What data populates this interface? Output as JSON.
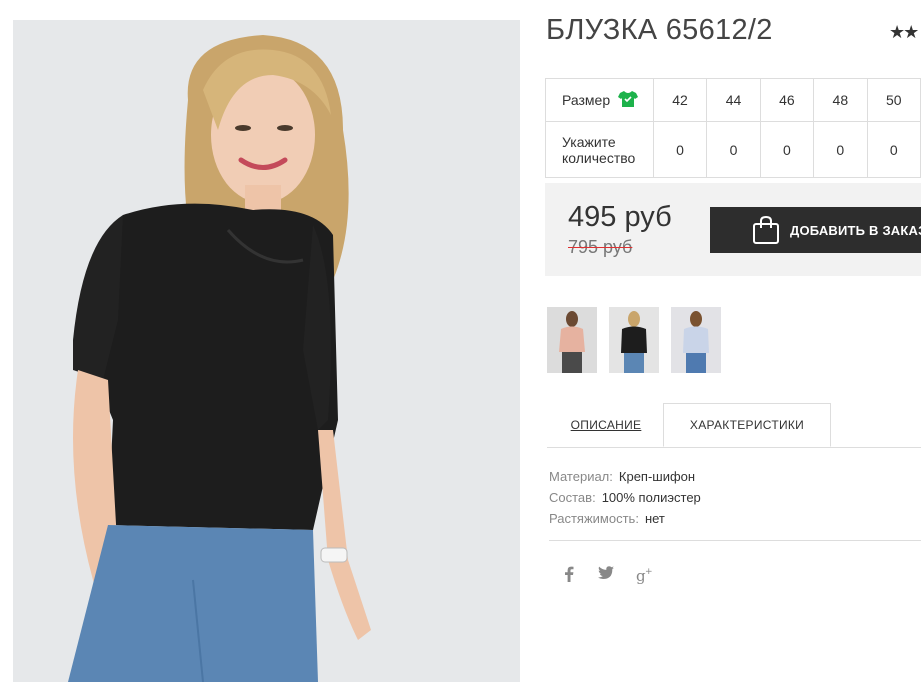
{
  "product": {
    "title": "БЛУЗКА 65612/2",
    "rating_stars": "★★"
  },
  "sizes": {
    "size_label": "Размер",
    "size_icon": "tshirt-icon",
    "quantity_label": "Укажите количество",
    "columns": [
      {
        "size": "42",
        "qty": "0"
      },
      {
        "size": "44",
        "qty": "0"
      },
      {
        "size": "46",
        "qty": "0"
      },
      {
        "size": "48",
        "qty": "0"
      },
      {
        "size": "50",
        "qty": "0"
      }
    ]
  },
  "pricing": {
    "price": "495 руб",
    "old_price": "795 руб",
    "add_button_label": "ДОБАВИТЬ В ЗАКАЗ",
    "add_button_icon": "shopping-bag-icon"
  },
  "tabs": [
    {
      "label": "ОПИСАНИЕ",
      "active": false
    },
    {
      "label": "ХАРАКТЕРИСТИКИ",
      "active": true
    }
  ],
  "specs": [
    {
      "key": "Материал:",
      "value": "Креп-шифон"
    },
    {
      "key": "Состав:",
      "value": "100% полиэстер"
    },
    {
      "key": "Растяжимость:",
      "value": "нет"
    }
  ],
  "social": [
    {
      "icon": "facebook-icon",
      "glyph": "f"
    },
    {
      "icon": "twitter-icon",
      "glyph": "t"
    },
    {
      "icon": "google-plus-icon",
      "glyph": "g+"
    }
  ],
  "colors": {
    "accent_green": "#1db24b",
    "button_dark": "#2d2d2d",
    "strike_red": "#e03030",
    "price_bg": "#f2f2f2"
  }
}
